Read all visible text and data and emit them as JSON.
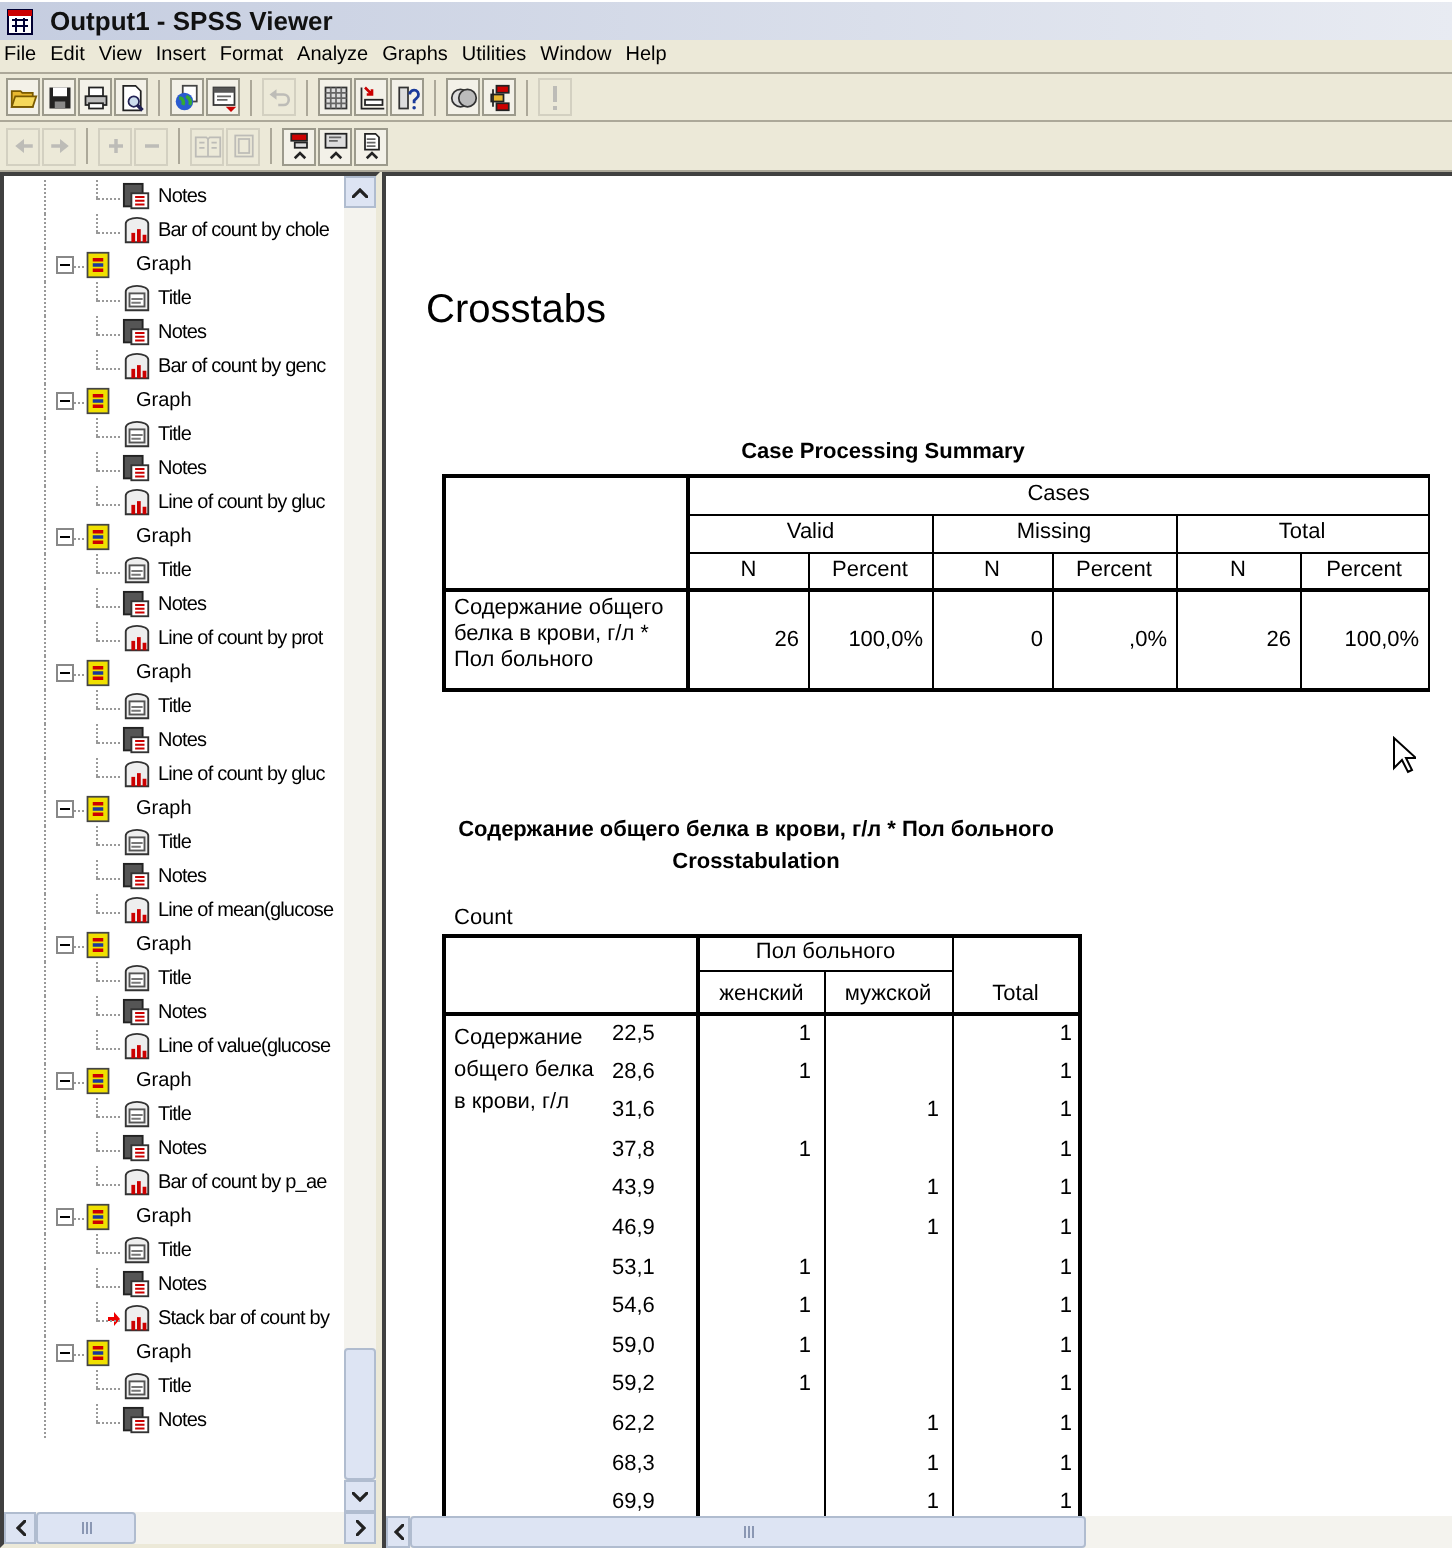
{
  "window": {
    "title": "Output1 - SPSS Viewer"
  },
  "menu": [
    "File",
    "Edit",
    "View",
    "Insert",
    "Format",
    "Analyze",
    "Graphs",
    "Utilities",
    "Window",
    "Help"
  ],
  "toolbar_1": [
    {
      "kind": "folder",
      "disabled": false,
      "separator_before": false
    },
    {
      "kind": "disk",
      "disabled": false,
      "separator_before": false
    },
    {
      "kind": "printer",
      "disabled": false,
      "separator_before": false
    },
    {
      "kind": "preview",
      "disabled": false,
      "separator_before": false
    },
    {
      "kind": "globe",
      "disabled": false,
      "separator_before": true
    },
    {
      "kind": "dialog",
      "disabled": false,
      "separator_before": false
    },
    {
      "kind": "undo",
      "disabled": true,
      "separator_before": true
    },
    {
      "kind": "grid",
      "disabled": false,
      "separator_before": true
    },
    {
      "kind": "goto",
      "disabled": false,
      "separator_before": false
    },
    {
      "kind": "variable",
      "disabled": false,
      "separator_before": false
    },
    {
      "kind": "circles",
      "disabled": false,
      "separator_before": true
    },
    {
      "kind": "designate",
      "disabled": false,
      "separator_before": false
    },
    {
      "kind": "exclaim",
      "disabled": true,
      "separator_before": true
    }
  ],
  "toolbar_2": [
    {
      "kind": "back",
      "disabled": true,
      "separator_before": false
    },
    {
      "kind": "forward",
      "disabled": true,
      "separator_before": false
    },
    {
      "kind": "plus",
      "disabled": true,
      "separator_before": true
    },
    {
      "kind": "minus",
      "disabled": true,
      "separator_before": false
    },
    {
      "kind": "book",
      "disabled": true,
      "separator_before": true
    },
    {
      "kind": "page",
      "disabled": true,
      "separator_before": false
    },
    {
      "kind": "promote-red",
      "disabled": false,
      "separator_before": true
    },
    {
      "kind": "promote-screen",
      "disabled": false,
      "separator_before": false
    },
    {
      "kind": "promote-doc",
      "disabled": false,
      "separator_before": false
    }
  ],
  "outline": {
    "orphan_items": [
      {
        "label": "Notes",
        "kind": "notes",
        "current": false
      },
      {
        "label": "Bar of count by chole",
        "kind": "chart",
        "current": false
      }
    ],
    "items": [
      {
        "label": "Graph",
        "kind": "graph",
        "expanded": true,
        "children": [
          {
            "label": "Title",
            "kind": "title",
            "current": false
          },
          {
            "label": "Notes",
            "kind": "notes",
            "current": false
          },
          {
            "label": "Bar of count by genc",
            "kind": "chart",
            "current": false
          }
        ]
      },
      {
        "label": "Graph",
        "kind": "graph",
        "expanded": true,
        "children": [
          {
            "label": "Title",
            "kind": "title",
            "current": false
          },
          {
            "label": "Notes",
            "kind": "notes",
            "current": false
          },
          {
            "label": "Line of count by gluc",
            "kind": "chart",
            "current": false
          }
        ]
      },
      {
        "label": "Graph",
        "kind": "graph",
        "expanded": true,
        "children": [
          {
            "label": "Title",
            "kind": "title",
            "current": false
          },
          {
            "label": "Notes",
            "kind": "notes",
            "current": false
          },
          {
            "label": "Line of count by prot",
            "kind": "chart",
            "current": false
          }
        ]
      },
      {
        "label": "Graph",
        "kind": "graph",
        "expanded": true,
        "children": [
          {
            "label": "Title",
            "kind": "title",
            "current": false
          },
          {
            "label": "Notes",
            "kind": "notes",
            "current": false
          },
          {
            "label": "Line of count by gluc",
            "kind": "chart",
            "current": false
          }
        ]
      },
      {
        "label": "Graph",
        "kind": "graph",
        "expanded": true,
        "children": [
          {
            "label": "Title",
            "kind": "title",
            "current": false
          },
          {
            "label": "Notes",
            "kind": "notes",
            "current": false
          },
          {
            "label": "Line of mean(glucose",
            "kind": "chart",
            "current": false
          }
        ]
      },
      {
        "label": "Graph",
        "kind": "graph",
        "expanded": true,
        "children": [
          {
            "label": "Title",
            "kind": "title",
            "current": false
          },
          {
            "label": "Notes",
            "kind": "notes",
            "current": false
          },
          {
            "label": "Line of value(glucose",
            "kind": "chart",
            "current": false
          }
        ]
      },
      {
        "label": "Graph",
        "kind": "graph",
        "expanded": true,
        "children": [
          {
            "label": "Title",
            "kind": "title",
            "current": false
          },
          {
            "label": "Notes",
            "kind": "notes",
            "current": false
          },
          {
            "label": "Bar of count by p_ae",
            "kind": "chart",
            "current": false
          }
        ]
      },
      {
        "label": "Graph",
        "kind": "graph",
        "expanded": true,
        "children": [
          {
            "label": "Title",
            "kind": "title",
            "current": false
          },
          {
            "label": "Notes",
            "kind": "notes",
            "current": false
          },
          {
            "label": "Stack bar of count by",
            "kind": "chart",
            "current": true
          }
        ]
      },
      {
        "label": "Graph",
        "kind": "graph",
        "expanded": true,
        "children": [
          {
            "label": "Title",
            "kind": "title",
            "current": false
          },
          {
            "label": "Notes",
            "kind": "notes",
            "current": false
          }
        ]
      }
    ]
  },
  "output": {
    "heading": "Crosstabs",
    "case_summary": {
      "title": "Case Processing Summary",
      "group_header": "Cases",
      "subgroups": [
        "Valid",
        "Missing",
        "Total"
      ],
      "columns": [
        "N",
        "Percent",
        "N",
        "Percent",
        "N",
        "Percent"
      ],
      "rows": [
        {
          "label": "Содержание общего белка в крови, г/л * Пол больного",
          "values": [
            "26",
            "100,0%",
            "0",
            ",0%",
            "26",
            "100,0%"
          ]
        }
      ]
    },
    "crosstab": {
      "title_lines": [
        "Содержание общего белка в крови, г/л * Пол больного",
        "Crosstabulation"
      ],
      "statistic": "Count",
      "row_variable": "Содержание общего белка в крови, г/л",
      "column_variable": "Пол больного",
      "columns": [
        "женский",
        "мужской"
      ],
      "total_header": "Total",
      "rows": [
        {
          "value": "22,5",
          "cells": [
            "1",
            null
          ],
          "total": "1"
        },
        {
          "value": "28,6",
          "cells": [
            "1",
            null
          ],
          "total": "1"
        },
        {
          "value": "31,6",
          "cells": [
            null,
            "1"
          ],
          "total": "1"
        },
        {
          "value": "37,8",
          "cells": [
            "1",
            null
          ],
          "total": "1"
        },
        {
          "value": "43,9",
          "cells": [
            null,
            "1"
          ],
          "total": "1"
        },
        {
          "value": "46,9",
          "cells": [
            null,
            "1"
          ],
          "total": "1"
        },
        {
          "value": "53,1",
          "cells": [
            "1",
            null
          ],
          "total": "1"
        },
        {
          "value": "54,6",
          "cells": [
            "1",
            null
          ],
          "total": "1"
        },
        {
          "value": "59,0",
          "cells": [
            "1",
            null
          ],
          "total": "1"
        },
        {
          "value": "59,2",
          "cells": [
            "1",
            null
          ],
          "total": "1"
        },
        {
          "value": "62,2",
          "cells": [
            null,
            "1"
          ],
          "total": "1"
        },
        {
          "value": "68,3",
          "cells": [
            null,
            "1"
          ],
          "total": "1"
        },
        {
          "value": "69,9",
          "cells": [
            null,
            "1"
          ],
          "total": "1"
        }
      ]
    }
  }
}
